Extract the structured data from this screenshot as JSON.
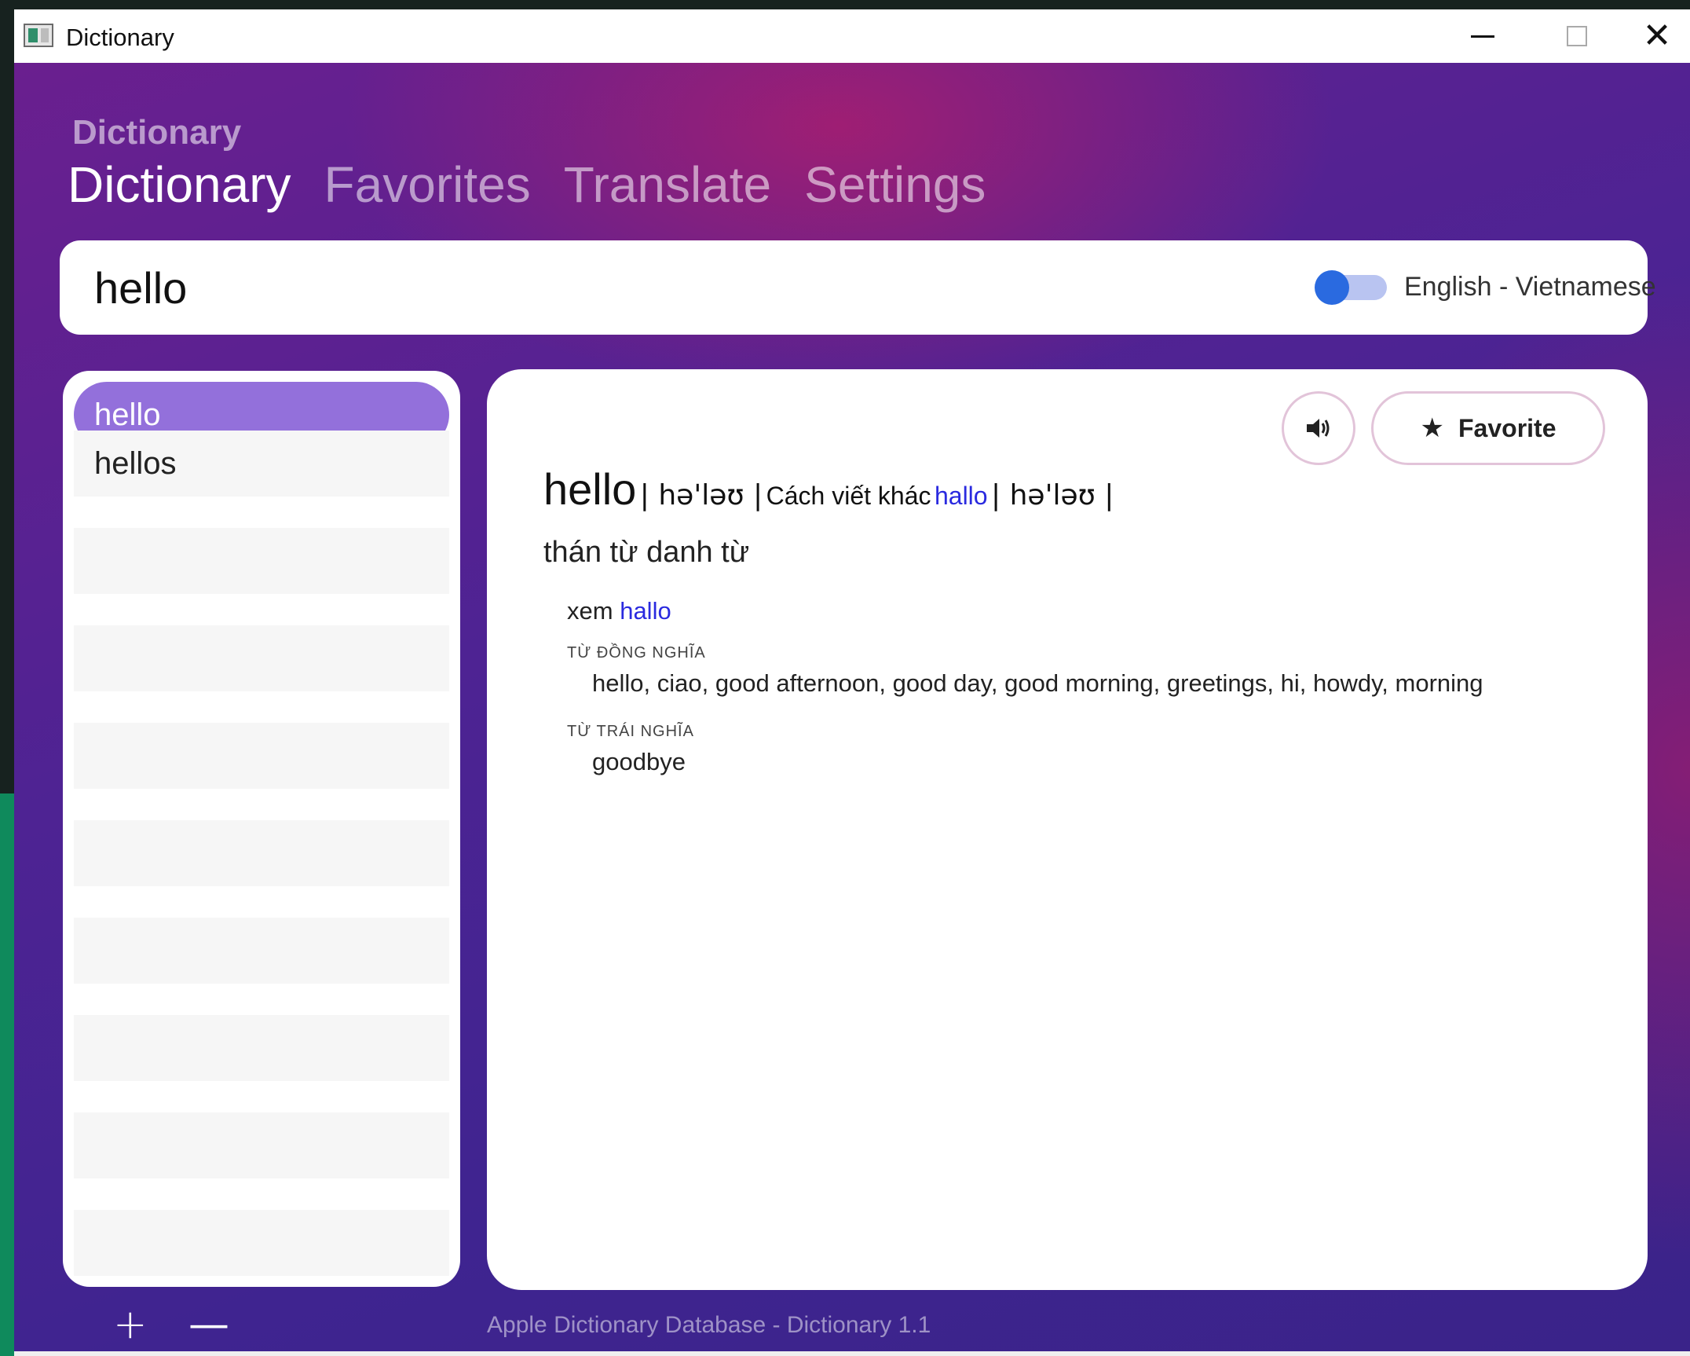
{
  "window": {
    "title": "Dictionary"
  },
  "header": {
    "section_title": "Dictionary",
    "tabs": [
      {
        "label": "Dictionary",
        "active": true
      },
      {
        "label": "Favorites",
        "active": false
      },
      {
        "label": "Translate",
        "active": false
      },
      {
        "label": "Settings",
        "active": false
      }
    ]
  },
  "search": {
    "value": "hello",
    "placeholder": "",
    "toggle_on": false,
    "language_label": "English - Vietnamese"
  },
  "word_list": {
    "items": [
      {
        "label": "hello",
        "selected": true
      },
      {
        "label": "hellos",
        "selected": false
      }
    ]
  },
  "entry": {
    "headword": "hello",
    "pronunciation_1": "| hə'ləʊ |",
    "alt_spelling_prefix": "Cách viết khác",
    "alt_spelling_link": "hallo",
    "pronunciation_2": "| hə'ləʊ |",
    "part_of_speech": "thán từ danh từ",
    "see_prefix": "xem",
    "see_link": "hallo",
    "synonyms_label": "TỪ ĐỒNG NGHĨA",
    "synonyms": "hello, ciao, good afternoon, good day, good morning, greetings, hi, howdy, morning",
    "antonyms_label": "TỪ TRÁI NGHĨA",
    "antonyms": "goodbye"
  },
  "actions": {
    "favorite_label": "Favorite",
    "favorite_icon": "star-icon",
    "speak_icon": "speaker-icon"
  },
  "footer": {
    "add_label": "+",
    "remove_label": "—",
    "info": "Apple Dictionary Database - Dictionary 1.1"
  },
  "colors": {
    "accent_purple": "#9370db",
    "link_blue": "#2a2adf",
    "toggle_knob": "#2a6ae0",
    "toggle_track": "#b9c4f1",
    "background_gradient_start": "#6a1f8f",
    "background_gradient_end": "#3a2389",
    "button_border": "#e2c4d9"
  }
}
